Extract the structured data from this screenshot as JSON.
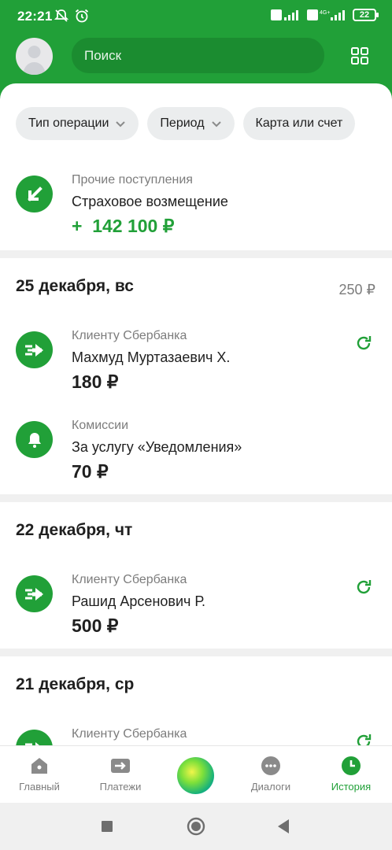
{
  "status_bar": {
    "time": "22:21",
    "battery": "22"
  },
  "header": {
    "search_placeholder": "Поиск"
  },
  "filters": [
    {
      "label": "Тип операции"
    },
    {
      "label": "Период"
    },
    {
      "label": "Карта или счет"
    }
  ],
  "top_operation": {
    "category": "Прочие поступления",
    "name": "Страховое возмещение",
    "amount": "+  142 100 ₽"
  },
  "days": [
    {
      "date": "25 декабря, вс",
      "total": "250 ₽",
      "operations": [
        {
          "category": "Клиенту Сбербанка",
          "name": "Махмуд Муртазаевич Х.",
          "amount": "180 ₽",
          "icon": "transfer-arrow-icon",
          "repeatable": true
        },
        {
          "category": "Комиссии",
          "name": "За услугу «Уведомления»",
          "amount": "70 ₽",
          "icon": "bell-icon",
          "repeatable": false
        }
      ]
    },
    {
      "date": "22 декабря, чт",
      "total": "",
      "operations": [
        {
          "category": "Клиенту Сбербанка",
          "name": "Рашид Арсенович Р.",
          "amount": "500 ₽",
          "icon": "transfer-arrow-icon",
          "repeatable": true
        }
      ]
    },
    {
      "date": "21 декабря, ср",
      "total": "",
      "operations": [
        {
          "category": "Клиенту Сбербанка",
          "name": "",
          "amount": "",
          "icon": "transfer-arrow-icon",
          "repeatable": true
        }
      ]
    }
  ],
  "bottom_nav": {
    "items": [
      {
        "label": "Главный",
        "icon": "home-icon"
      },
      {
        "label": "Платежи",
        "icon": "payments-icon"
      },
      {
        "label": "",
        "icon": "assistant-orb-icon"
      },
      {
        "label": "Диалоги",
        "icon": "dialogs-icon"
      },
      {
        "label": "История",
        "icon": "history-icon",
        "active": true
      }
    ]
  },
  "colors": {
    "brand": "#21a038",
    "text": "#1f1f1f",
    "muted": "#7c7c7c",
    "background": "#f0f0f0"
  }
}
